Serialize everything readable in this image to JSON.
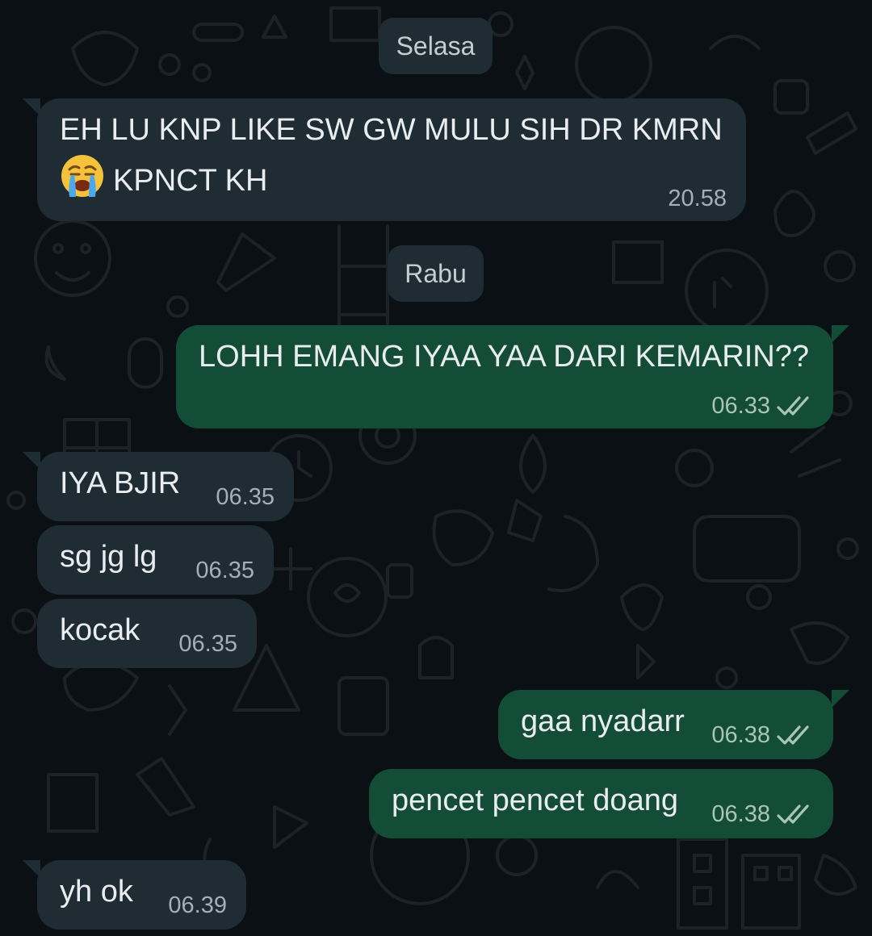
{
  "dates": {
    "d1": "Selasa",
    "d2": "Rabu"
  },
  "messages": [
    {
      "dir": "in",
      "line1": "EH LU KNP LIKE SW GW MULU SIH DR KMRN",
      "line2": "KPNCT KH",
      "emoji": "crying-face",
      "time": "20.58"
    },
    {
      "dir": "out",
      "text": "LOHH EMANG IYAA YAA DARI KEMARIN??",
      "time": "06.33",
      "status": "read"
    },
    {
      "dir": "in",
      "text": "IYA BJIR",
      "time": "06.35"
    },
    {
      "dir": "in",
      "text": "sg jg lg",
      "time": "06.35"
    },
    {
      "dir": "in",
      "text": "kocak",
      "time": "06.35"
    },
    {
      "dir": "out",
      "text": "gaa nyadarr",
      "time": "06.38",
      "status": "read"
    },
    {
      "dir": "out",
      "text": "pencet pencet doang",
      "time": "06.38",
      "status": "read"
    },
    {
      "dir": "in",
      "text": "yh ok",
      "time": "06.39"
    }
  ],
  "colors": {
    "background": "#0b1014",
    "incoming_bubble": "#1f2c33",
    "outgoing_bubble": "#144d37",
    "text": "#e9edef"
  }
}
